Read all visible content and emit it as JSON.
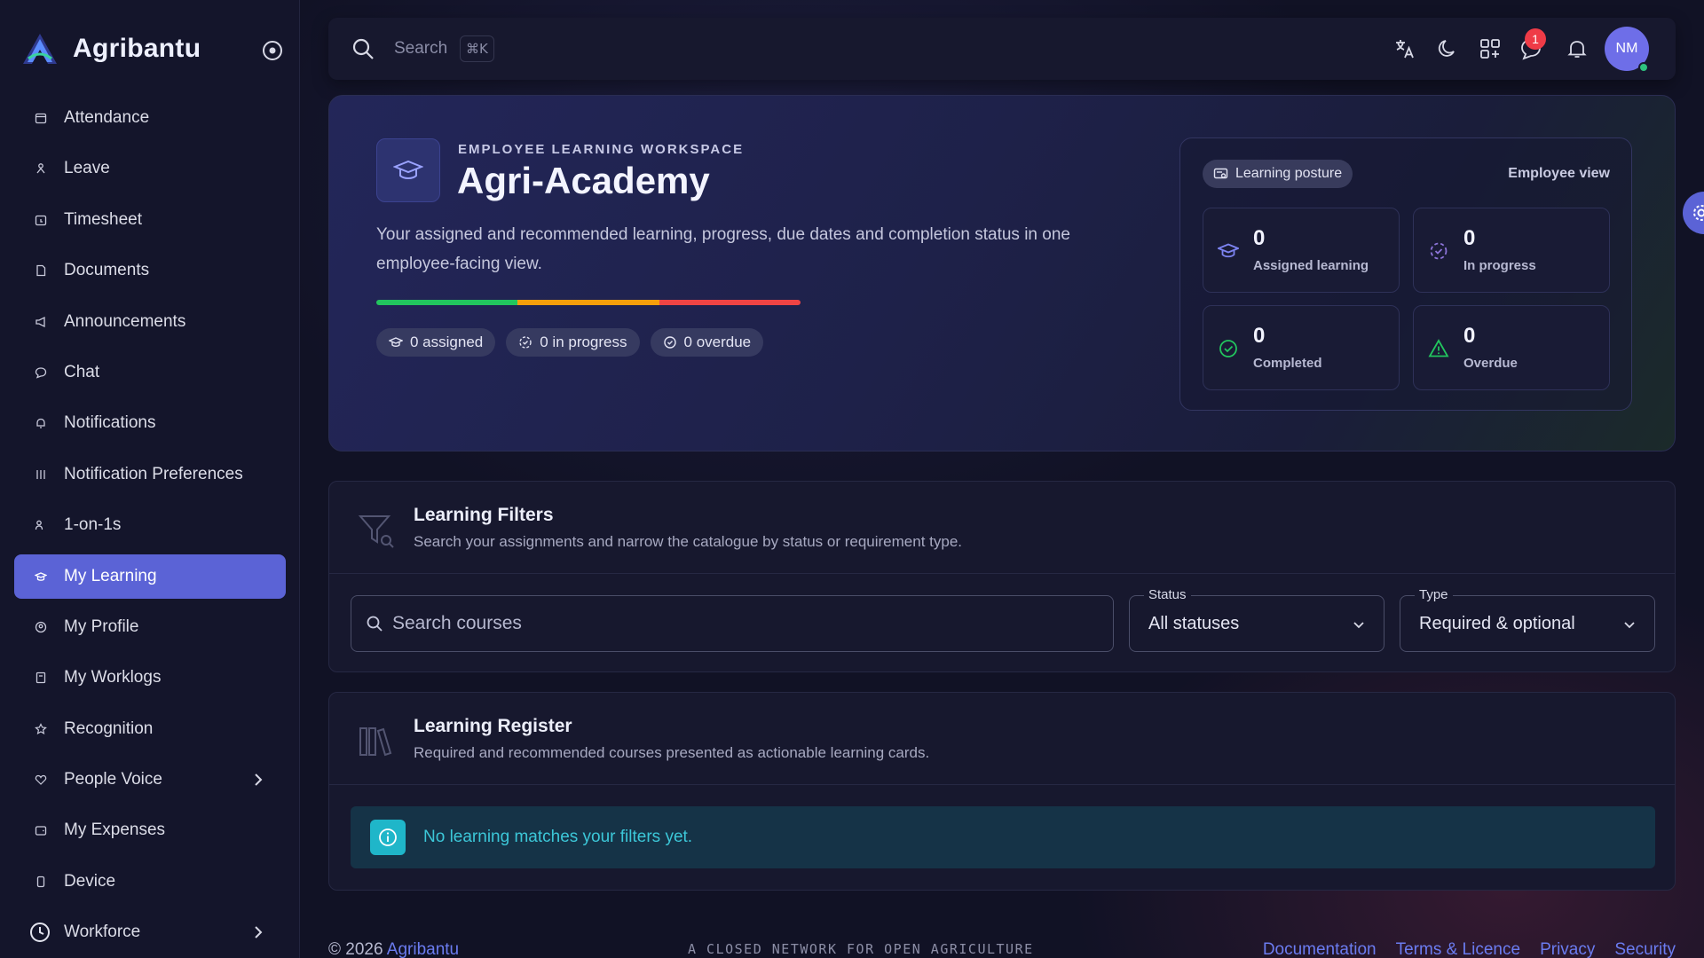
{
  "brand": {
    "name": "Agribantu"
  },
  "sidebar": {
    "items": [
      {
        "label": "Attendance",
        "icon": "calendar-icon"
      },
      {
        "label": "Leave",
        "icon": "leave-icon"
      },
      {
        "label": "Timesheet",
        "icon": "timesheet-icon"
      },
      {
        "label": "Documents",
        "icon": "document-icon"
      },
      {
        "label": "Announcements",
        "icon": "megaphone-icon"
      },
      {
        "label": "Chat",
        "icon": "chat-icon"
      },
      {
        "label": "Notifications",
        "icon": "bell-icon"
      },
      {
        "label": "Notification Preferences",
        "icon": "sliders-icon"
      },
      {
        "label": "1-on-1s",
        "icon": "users-icon"
      },
      {
        "label": "My Learning",
        "icon": "graduation-cap-icon",
        "active": true
      },
      {
        "label": "My Profile",
        "icon": "user-circle-icon"
      },
      {
        "label": "My Worklogs",
        "icon": "worklog-icon"
      },
      {
        "label": "Recognition",
        "icon": "star-icon"
      },
      {
        "label": "People Voice",
        "icon": "heart-icon",
        "expandable": true
      },
      {
        "label": "My Expenses",
        "icon": "wallet-icon"
      },
      {
        "label": "Device",
        "icon": "device-icon"
      },
      {
        "label": "Workforce",
        "icon": "clock-icon",
        "expandable": true
      }
    ]
  },
  "topbar": {
    "search_label": "Search",
    "search_shortcut": "⌘K",
    "chat_badge": "1",
    "avatar_initials": "NM"
  },
  "hero": {
    "eyebrow": "EMPLOYEE LEARNING WORKSPACE",
    "title": "Agri-Academy",
    "description": "Your assigned and recommended learning, progress, due dates and completion status in one employee-facing view.",
    "progress_colors": [
      "#22c55e",
      "#f59e0b",
      "#ef4444"
    ],
    "pills": [
      {
        "label": "0 assigned",
        "icon": "graduation-cap-icon"
      },
      {
        "label": "0 in progress",
        "icon": "progress-icon"
      },
      {
        "label": "0 overdue",
        "icon": "check-circle-icon"
      }
    ],
    "posture": {
      "chip_label": "Learning posture",
      "view_label": "Employee view",
      "stats": [
        {
          "value": "0",
          "label": "Assigned learning",
          "icon": "graduation-cap-icon",
          "color": "#7c83f0"
        },
        {
          "value": "0",
          "label": "In progress",
          "icon": "progress-icon",
          "color": "#8c74d8"
        },
        {
          "value": "0",
          "label": "Completed",
          "icon": "check-circle-icon",
          "color": "#22c55e"
        },
        {
          "value": "0",
          "label": "Overdue",
          "icon": "warning-icon",
          "color": "#22c55e"
        }
      ]
    }
  },
  "filters": {
    "title": "Learning Filters",
    "subtitle": "Search your assignments and narrow the catalogue by status or requirement type.",
    "search_placeholder": "Search courses",
    "status": {
      "label": "Status",
      "value": "All statuses"
    },
    "type": {
      "label": "Type",
      "value": "Required & optional"
    }
  },
  "register": {
    "title": "Learning Register",
    "subtitle": "Required and recommended courses presented as actionable learning cards.",
    "empty_message": "No learning matches your filters yet."
  },
  "footer": {
    "copyright": "© 2026",
    "brand_link": "Agribantu",
    "tagline": "A CLOSED NETWORK FOR OPEN AGRICULTURE",
    "links": [
      "Documentation",
      "Terms & Licence",
      "Privacy",
      "Security"
    ]
  }
}
